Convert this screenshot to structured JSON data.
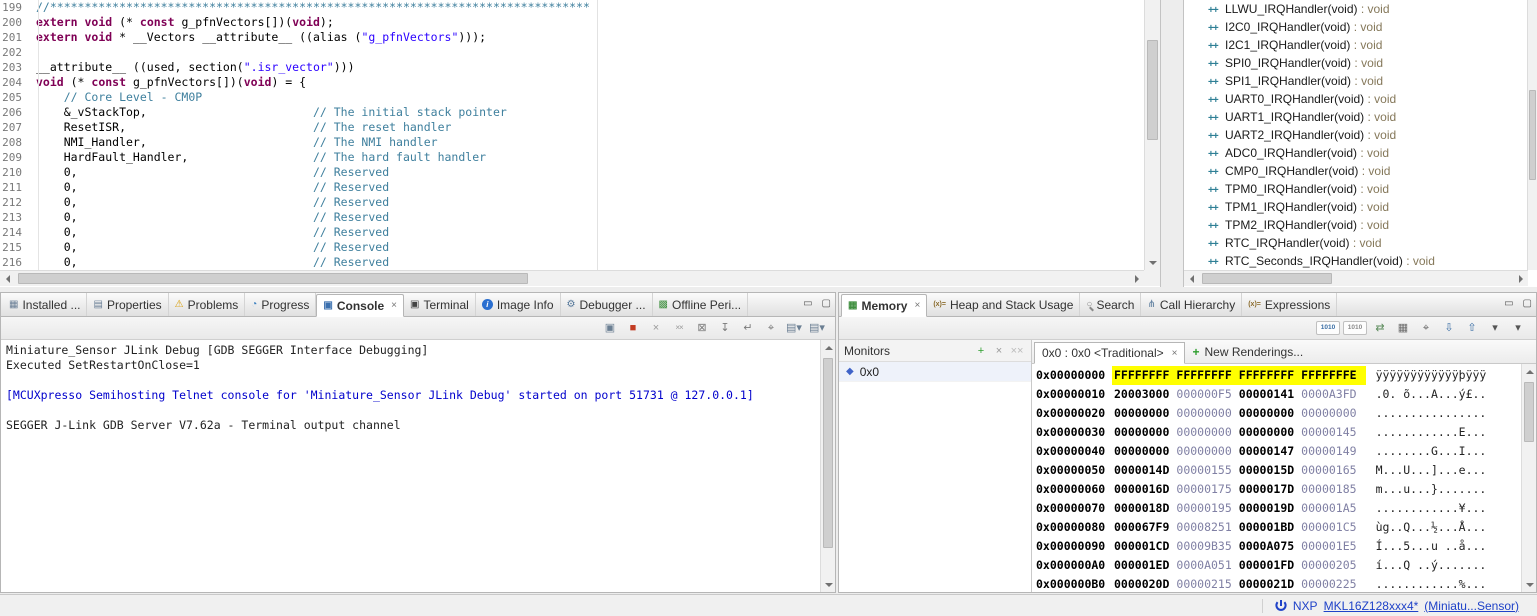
{
  "colors": {
    "keyword": "#7f0055",
    "comment": "#3e7f9d",
    "string": "#2a00ff",
    "highlight": "#ffff00",
    "link_blue": "#1f42c8",
    "console_blue": "#0000cc"
  },
  "glyphs": {
    "close": "×",
    "plus": "+",
    "min": "▭",
    "max": "▢"
  },
  "editor": {
    "lines": [
      {
        "n": "199",
        "segs": [
          [
            "c",
            "//******************************************************************************"
          ]
        ]
      },
      {
        "n": "200",
        "segs": [
          [
            "k",
            "extern"
          ],
          [
            "p",
            " "
          ],
          [
            "k",
            "void"
          ],
          [
            "p",
            " (* "
          ],
          [
            "k",
            "const"
          ],
          [
            "p",
            " g_pfnVectors[])("
          ],
          [
            "k",
            "void"
          ],
          [
            "p",
            ");"
          ]
        ]
      },
      {
        "n": "201",
        "segs": [
          [
            "k",
            "extern"
          ],
          [
            "p",
            " "
          ],
          [
            "k",
            "void"
          ],
          [
            "p",
            " * __Vectors __attribute__ ((alias ("
          ],
          [
            "s",
            "\"g_pfnVectors\""
          ],
          [
            "p",
            ")));"
          ]
        ]
      },
      {
        "n": "202",
        "segs": []
      },
      {
        "n": "203",
        "segs": [
          [
            "p",
            "__attribute__ ((used, section("
          ],
          [
            "s",
            "\".isr_vector\""
          ],
          [
            "p",
            ")))"
          ]
        ]
      },
      {
        "n": "204",
        "segs": [
          [
            "k",
            "void"
          ],
          [
            "p",
            " (* "
          ],
          [
            "k",
            "const"
          ],
          [
            "p",
            " g_pfnVectors[])("
          ],
          [
            "k",
            "void"
          ],
          [
            "p",
            ") = {"
          ]
        ]
      },
      {
        "n": "205",
        "segs": [
          [
            "c",
            "    // Core Level - CM0P"
          ]
        ]
      },
      {
        "n": "206",
        "segs": [
          [
            "p",
            "    &_vStackTop,                        "
          ],
          [
            "c",
            "// The initial stack pointer"
          ]
        ]
      },
      {
        "n": "207",
        "segs": [
          [
            "p",
            "    ResetISR,                           "
          ],
          [
            "c",
            "// The reset handler"
          ]
        ]
      },
      {
        "n": "208",
        "segs": [
          [
            "p",
            "    NMI_Handler,                        "
          ],
          [
            "c",
            "// The NMI handler"
          ]
        ]
      },
      {
        "n": "209",
        "segs": [
          [
            "p",
            "    HardFault_Handler,                  "
          ],
          [
            "c",
            "// The hard fault handler"
          ]
        ]
      },
      {
        "n": "210",
        "segs": [
          [
            "p",
            "    0,                                  "
          ],
          [
            "c",
            "// Reserved"
          ]
        ]
      },
      {
        "n": "211",
        "segs": [
          [
            "p",
            "    0,                                  "
          ],
          [
            "c",
            "// Reserved"
          ]
        ]
      },
      {
        "n": "212",
        "segs": [
          [
            "p",
            "    0,                                  "
          ],
          [
            "c",
            "// Reserved"
          ]
        ]
      },
      {
        "n": "213",
        "segs": [
          [
            "p",
            "    0,                                  "
          ],
          [
            "c",
            "// Reserved"
          ]
        ]
      },
      {
        "n": "214",
        "segs": [
          [
            "p",
            "    0,                                  "
          ],
          [
            "c",
            "// Reserved"
          ]
        ]
      },
      {
        "n": "215",
        "segs": [
          [
            "p",
            "    0,                                  "
          ],
          [
            "c",
            "// Reserved"
          ]
        ]
      },
      {
        "n": "216",
        "segs": [
          [
            "p",
            "    0,                                  "
          ],
          [
            "c",
            "// Reserved"
          ]
        ]
      }
    ]
  },
  "outline": {
    "icon_glyph": "++",
    "items": [
      {
        "name": "LLWU_IRQHandler(void)",
        "type": "void"
      },
      {
        "name": "I2C0_IRQHandler(void)",
        "type": "void"
      },
      {
        "name": "I2C1_IRQHandler(void)",
        "type": "void"
      },
      {
        "name": "SPI0_IRQHandler(void)",
        "type": "void"
      },
      {
        "name": "SPI1_IRQHandler(void)",
        "type": "void"
      },
      {
        "name": "UART0_IRQHandler(void)",
        "type": "void"
      },
      {
        "name": "UART1_IRQHandler(void)",
        "type": "void"
      },
      {
        "name": "UART2_IRQHandler(void)",
        "type": "void"
      },
      {
        "name": "ADC0_IRQHandler(void)",
        "type": "void"
      },
      {
        "name": "CMP0_IRQHandler(void)",
        "type": "void"
      },
      {
        "name": "TPM0_IRQHandler(void)",
        "type": "void"
      },
      {
        "name": "TPM1_IRQHandler(void)",
        "type": "void"
      },
      {
        "name": "TPM2_IRQHandler(void)",
        "type": "void"
      },
      {
        "name": "RTC_IRQHandler(void)",
        "type": "void"
      },
      {
        "name": "RTC_Seconds_IRQHandler(void)",
        "type": "void"
      }
    ]
  },
  "console_panel": {
    "tabs": [
      {
        "id": "installed",
        "label": "Installed ...",
        "icon": "▦",
        "color": "#6a7f96"
      },
      {
        "id": "properties",
        "label": "Properties",
        "icon": "▤",
        "color": "#6a7f96"
      },
      {
        "id": "problems",
        "label": "Problems",
        "icon": "⚠",
        "color": "#d79b00"
      },
      {
        "id": "progress",
        "label": "Progress",
        "icon": "◔",
        "color": "#3a7fbf"
      },
      {
        "id": "console",
        "label": "Console",
        "selected": true,
        "icon": "▣",
        "color": "#3a6fae"
      },
      {
        "id": "terminal",
        "label": "Terminal",
        "icon": "▣",
        "color": "#444444"
      },
      {
        "id": "image-info",
        "label": "Image Info",
        "icon": "i",
        "color": "#ffffff",
        "cls": "info"
      },
      {
        "id": "debugger",
        "label": "Debugger ...",
        "icon": "⚙",
        "color": "#557799"
      },
      {
        "id": "offline-peripherals",
        "label": "Offline Peri...",
        "icon": "▩",
        "color": "#3f8f3f"
      }
    ],
    "toolbar_icons": [
      {
        "name": "show-console-on-output-icon",
        "glyph": "▣",
        "color": "#6b7f93"
      },
      {
        "name": "terminate-button",
        "glyph": "■",
        "color": "#c23b22"
      },
      {
        "name": "remove-launch-button",
        "glyph": "×",
        "color": "#9a9a9a"
      },
      {
        "name": "remove-all-terminated-button",
        "glyph": "××",
        "color": "#9a9a9a",
        "cls": "dbl"
      },
      {
        "name": "clear-console-button",
        "glyph": "⊠",
        "color": "#7a7a7a"
      },
      {
        "name": "scroll-lock-button",
        "glyph": "↧",
        "color": "#7a7a7a"
      },
      {
        "name": "word-wrap-button",
        "glyph": "↵",
        "color": "#7a7a7a"
      },
      {
        "name": "pin-console-button",
        "glyph": "⌖",
        "color": "#7a7a7a"
      },
      {
        "name": "display-selected-console-button",
        "glyph": "▤▾",
        "color": "#6b7f93"
      },
      {
        "name": "open-console-dropdown",
        "glyph": "▤▾",
        "color": "#6b7f93"
      }
    ],
    "output": [
      {
        "text": "Miniature_Sensor JLink Debug [GDB SEGGER Interface Debugging]",
        "style": "plain"
      },
      {
        "text": "Executed SetRestartOnClose=1",
        "style": "plain"
      },
      {
        "text": "",
        "style": "plain"
      },
      {
        "text": "[MCUXpresso Semihosting Telnet console for 'Miniature_Sensor JLink Debug' started on port 51731 @ 127.0.0.1]",
        "style": "blue"
      },
      {
        "text": "",
        "style": "plain"
      },
      {
        "text": "SEGGER J-Link GDB Server V7.62a - Terminal output channel",
        "style": "plain"
      }
    ]
  },
  "memory_panel": {
    "tabs": [
      {
        "id": "memory",
        "label": "Memory",
        "selected": true,
        "icon": "▦",
        "color": "#3f8f3f"
      },
      {
        "id": "heap-stack-usage",
        "label": "Heap and Stack Usage",
        "icon": "(x)=",
        "color": "#8a6a2a",
        "cls": "small"
      },
      {
        "id": "search",
        "label": "Search",
        "icon": "○",
        "color": "#8a8a8a",
        "cls": "search"
      },
      {
        "id": "call-hierarchy",
        "label": "Call Hierarchy",
        "icon": "⋔",
        "color": "#557799"
      },
      {
        "id": "expressions",
        "label": "Expressions",
        "icon": "(x)=",
        "color": "#8a6a2a",
        "cls": "small"
      }
    ],
    "toolbar_icons": [
      {
        "name": "toggle-monitors-pane-icon",
        "glyph": "1010",
        "color": "#3a6ea5",
        "cls": "bin"
      },
      {
        "name": "toggle-renderings-pane-icon",
        "glyph": "1010",
        "color": "#8a8a8a",
        "cls": "bin"
      },
      {
        "name": "link-rendering-panes-icon",
        "glyph": "⇄",
        "color": "#5a8a5a"
      },
      {
        "name": "new-memory-view-icon",
        "glyph": "▦",
        "color": "#6a6a6a"
      },
      {
        "name": "pin-memory-monitor-icon",
        "glyph": "⌖",
        "color": "#6a6a6a"
      },
      {
        "name": "import-memory-icon",
        "glyph": "⇩",
        "color": "#3a6ea5"
      },
      {
        "name": "export-memory-icon",
        "glyph": "⇧",
        "color": "#3a6ea5"
      },
      {
        "name": "memory-layout-dropdown",
        "glyph": "▾",
        "color": "#555555"
      },
      {
        "name": "memory-view-menu",
        "glyph": "▾",
        "color": "#555555"
      }
    ],
    "monitors": {
      "title": "Monitors",
      "actions": [
        {
          "name": "add-memory-monitor-button",
          "glyph": "+",
          "color": "#2d9e2d",
          "cls": "bold"
        },
        {
          "name": "remove-memory-monitor-button",
          "glyph": "×",
          "color": "#999999"
        },
        {
          "name": "remove-all-monitors-button",
          "glyph": "××",
          "color": "#bbbbbb",
          "cls": "dbl"
        }
      ],
      "items": [
        "0x0"
      ]
    },
    "rendering_tabs": {
      "active": "0x0 : 0x0 <Traditional>",
      "new_label": "New Renderings..."
    },
    "rows": [
      {
        "addr": "0x00000000",
        "words": [
          "FFFFFFFF",
          "FFFFFFFF",
          "FFFFFFFF",
          "FFFFFFFE"
        ],
        "ascii": "ÿÿÿÿÿÿÿÿÿÿÿÿþÿÿÿ",
        "hl": true
      },
      {
        "addr": "0x00000010",
        "words": [
          "20003000",
          "000000F5",
          "00000141",
          "0000A3FD"
        ],
        "ascii": ".0. õ...A...ý£.."
      },
      {
        "addr": "0x00000020",
        "words": [
          "00000000",
          "00000000",
          "00000000",
          "00000000"
        ],
        "ascii": "................"
      },
      {
        "addr": "0x00000030",
        "words": [
          "00000000",
          "00000000",
          "00000000",
          "00000145"
        ],
        "ascii": "............E..."
      },
      {
        "addr": "0x00000040",
        "words": [
          "00000000",
          "00000000",
          "00000147",
          "00000149"
        ],
        "ascii": "........G...I..."
      },
      {
        "addr": "0x00000050",
        "words": [
          "0000014D",
          "00000155",
          "0000015D",
          "00000165"
        ],
        "ascii": "M...U...]...e..."
      },
      {
        "addr": "0x00000060",
        "words": [
          "0000016D",
          "00000175",
          "0000017D",
          "00000185"
        ],
        "ascii": "m...u...}......."
      },
      {
        "addr": "0x00000070",
        "words": [
          "0000018D",
          "00000195",
          "0000019D",
          "000001A5"
        ],
        "ascii": "............¥..."
      },
      {
        "addr": "0x00000080",
        "words": [
          "000067F9",
          "00008251",
          "000001BD",
          "000001C5"
        ],
        "ascii": "ùg..Q...½...Å..."
      },
      {
        "addr": "0x00000090",
        "words": [
          "000001CD",
          "00009B35",
          "0000A075",
          "000001E5"
        ],
        "ascii": "Í...5...u ..å..."
      },
      {
        "addr": "0x000000A0",
        "words": [
          "000001ED",
          "0000A051",
          "000001FD",
          "00000205"
        ],
        "ascii": "í...Q ..ý......."
      },
      {
        "addr": "0x000000B0",
        "words": [
          "0000020D",
          "00000215",
          "0000021D",
          "00000225"
        ],
        "ascii": "............%..."
      }
    ]
  },
  "statusbar": {
    "vendor": "NXP",
    "device": "MKL16Z128xxx4*",
    "project": "(Miniatu...Sensor)"
  }
}
